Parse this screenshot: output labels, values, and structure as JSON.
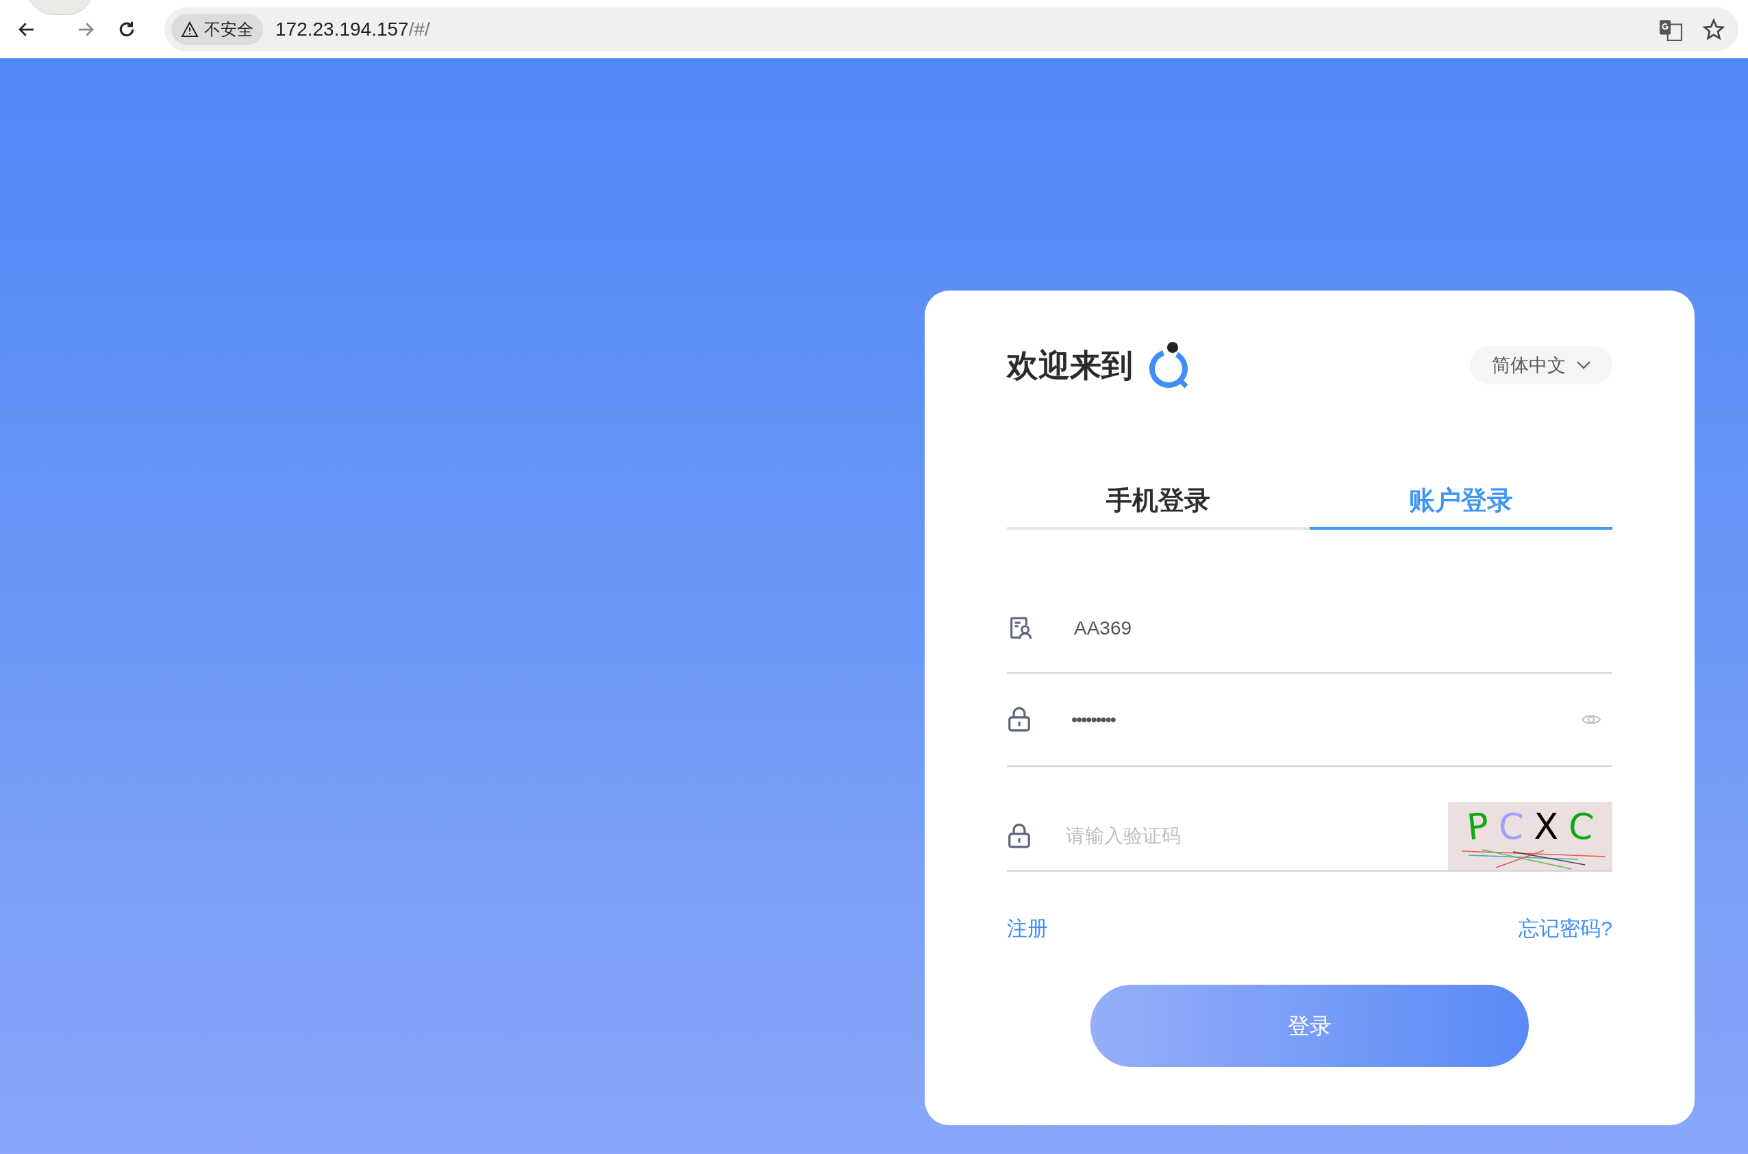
{
  "browser": {
    "security_label": "不安全",
    "url_host": "172.23.194.157",
    "url_path": "/#/"
  },
  "login_card": {
    "welcome": "欢迎来到",
    "language": "简体中文",
    "tabs": [
      {
        "label": "手机登录",
        "selected": false
      },
      {
        "label": "账户登录",
        "selected": true
      }
    ],
    "fields": [
      {
        "kind": "username",
        "value": "AA369"
      },
      {
        "kind": "password",
        "value": "•••••••••"
      },
      {
        "kind": "captcha",
        "placeholder": "请输入验证码",
        "captcha_chars": [
          {
            "char": "P",
            "color": "#10a810"
          },
          {
            "char": "C",
            "color": "#a0a0f8"
          },
          {
            "char": "X",
            "color": "#000000"
          },
          {
            "char": "C",
            "color": "#10a810"
          }
        ]
      }
    ],
    "register_link": "注册",
    "forgot_link": "忘记密码?",
    "submit": "登录"
  }
}
